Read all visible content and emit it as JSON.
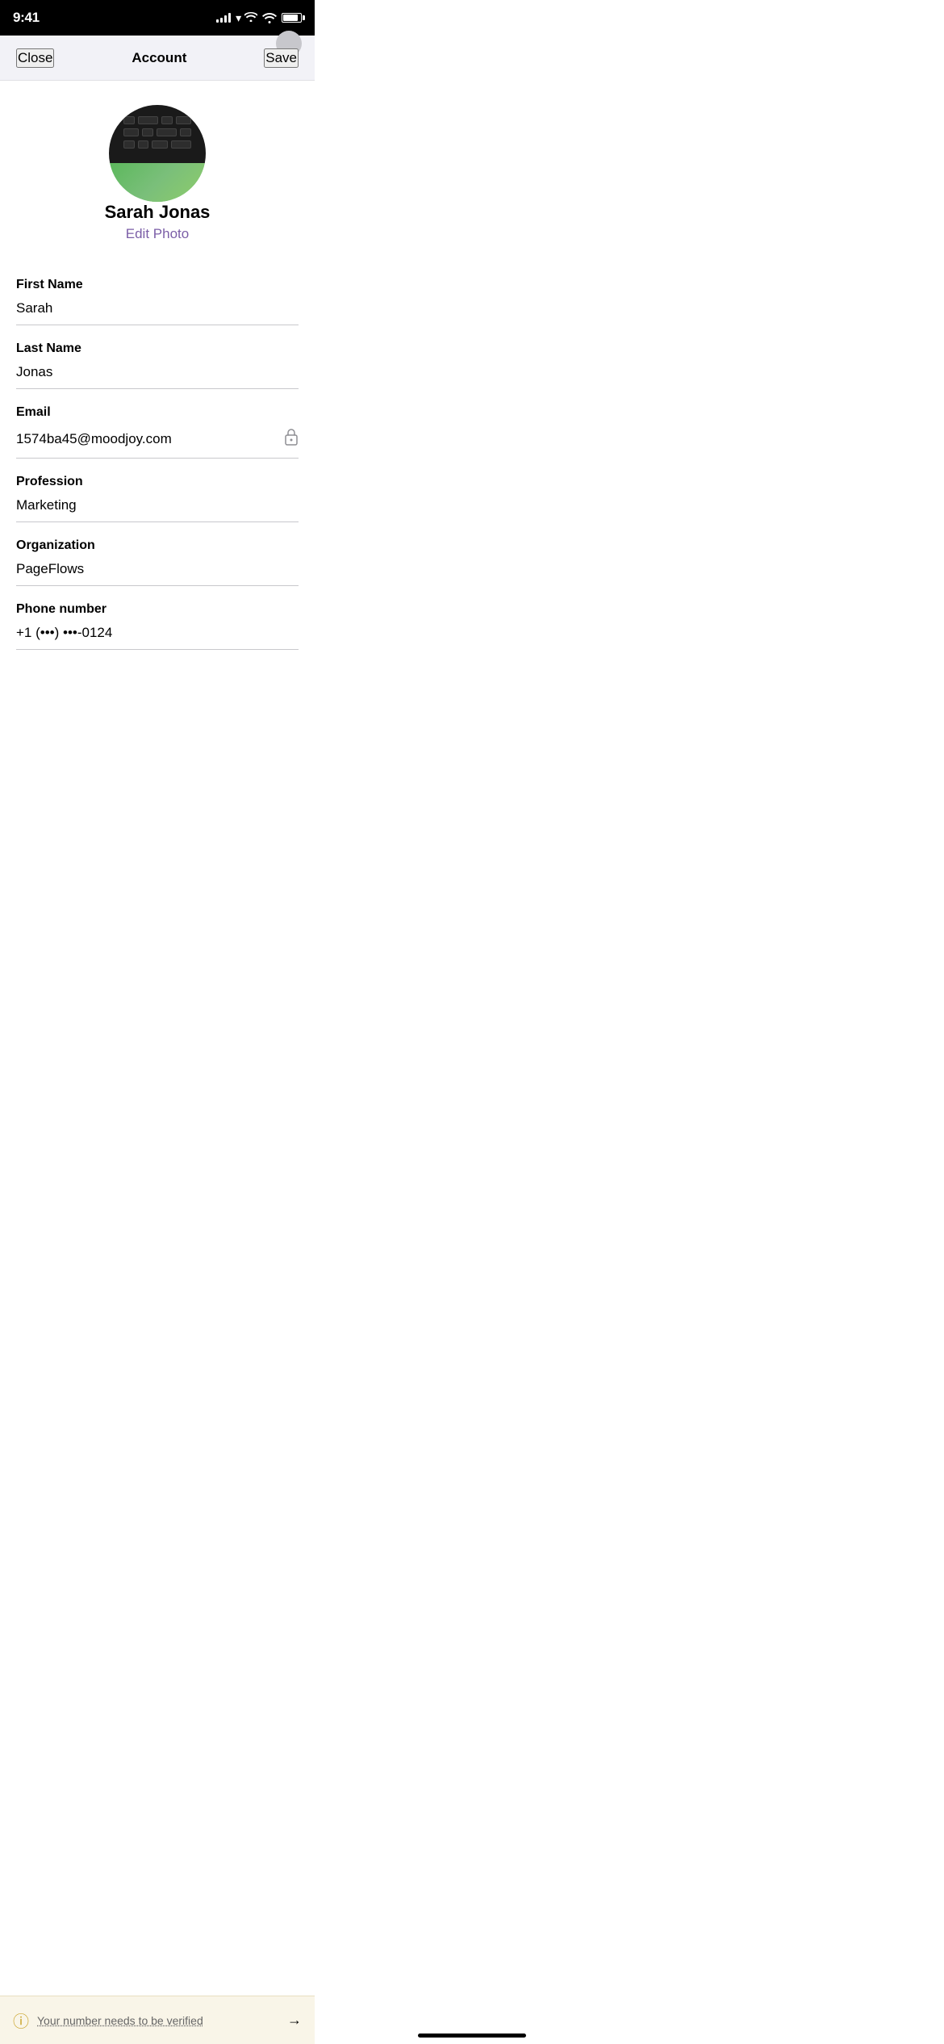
{
  "statusBar": {
    "time": "9:41"
  },
  "navBar": {
    "closeLabel": "Close",
    "title": "Account",
    "saveLabel": "Save"
  },
  "profile": {
    "name": "Sarah Jonas",
    "editPhotoLabel": "Edit Photo"
  },
  "fields": [
    {
      "id": "first-name",
      "label": "First Name",
      "value": "Sarah",
      "hasIcon": false
    },
    {
      "id": "last-name",
      "label": "Last Name",
      "value": "Jonas",
      "hasIcon": false
    },
    {
      "id": "email",
      "label": "Email",
      "value": "1574ba45@moodjoy.com",
      "hasIcon": true,
      "iconName": "lock-icon"
    },
    {
      "id": "profession",
      "label": "Profession",
      "value": "Marketing",
      "hasIcon": false
    },
    {
      "id": "organization",
      "label": "Organization",
      "value": "PageFlows",
      "hasIcon": false
    },
    {
      "id": "phone-number",
      "label": "Phone number",
      "value": "+1  (•••) •••-0124",
      "hasIcon": false
    }
  ],
  "notification": {
    "text": "Your number needs to be verified",
    "iconSymbol": "ⓘ",
    "arrowSymbol": "→"
  },
  "colors": {
    "accent": "#7b5ea7",
    "navBg": "#f2f2f7"
  }
}
